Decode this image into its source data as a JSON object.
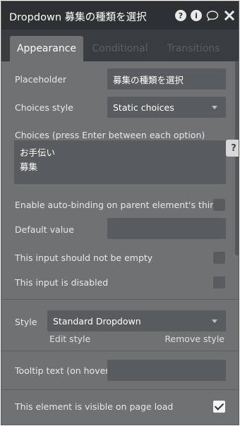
{
  "header": {
    "title": "Dropdown 募集の種類を選択",
    "icons": [
      "help-icon",
      "info-icon",
      "comment-icon",
      "close-icon"
    ]
  },
  "tabs": [
    {
      "label": "Appearance",
      "active": true
    },
    {
      "label": "Conditional",
      "active": false
    },
    {
      "label": "Transitions",
      "active": false
    }
  ],
  "form": {
    "placeholder_label": "Placeholder",
    "placeholder_value": "募集の種類を選択",
    "choices_style_label": "Choices style",
    "choices_style_value": "Static choices",
    "choices_label": "Choices (press Enter between each option)",
    "choices_lines": [
      "お手伝い",
      "募集"
    ],
    "auto_binding_label": "Enable auto-binding on parent element's thing",
    "auto_binding_checked": false,
    "default_value_label": "Default value",
    "default_value": "",
    "not_empty_label": "This input should not be empty",
    "not_empty_checked": false,
    "disabled_label": "This input is disabled",
    "disabled_checked": false
  },
  "style_section": {
    "style_label": "Style",
    "style_value": "Standard Dropdown",
    "edit_style": "Edit style",
    "remove_style": "Remove style"
  },
  "tooltip": {
    "label": "Tooltip text (on hover)",
    "value": ""
  },
  "visibility": {
    "label": "This element is visible on page load",
    "checked": true
  },
  "help_tab": "?",
  "colors": {
    "panel_bg": "#6f7173",
    "titlebar_bg": "#2e3133",
    "tabbar_bg": "#3a3d40",
    "field_bg": "#595c5f"
  }
}
